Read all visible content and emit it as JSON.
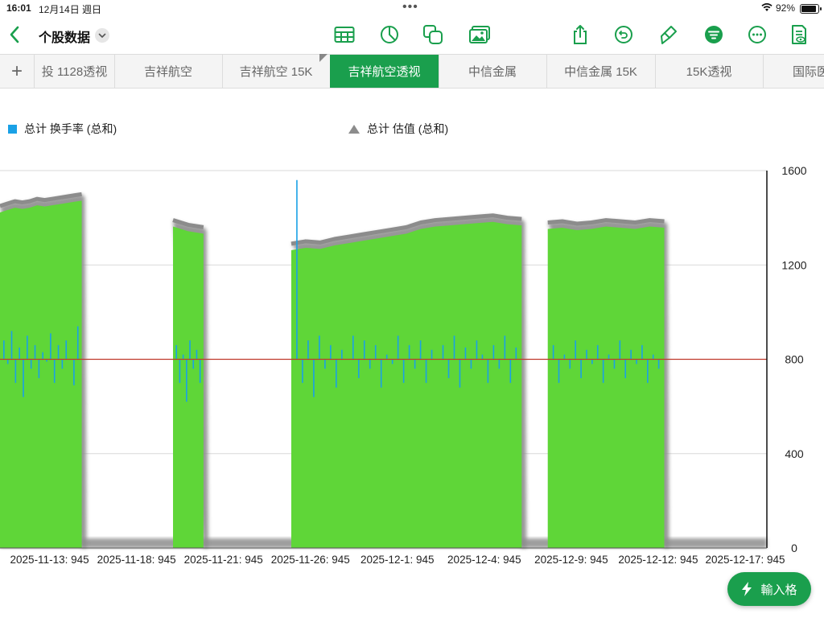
{
  "status_bar": {
    "time": "16:01",
    "date": "12月14日 週日",
    "battery": "92%",
    "battery_level": 0.92
  },
  "toolbar": {
    "title": "个股数据",
    "left_icons": [
      "back-icon",
      "chevron-down-icon"
    ],
    "center_icons": [
      "table-icon",
      "chart-icon",
      "shape-icon",
      "media-icon"
    ],
    "right_icons": [
      "share-icon",
      "undo-icon",
      "brush-icon",
      "organize-icon",
      "more-icon",
      "doc-view-icon"
    ]
  },
  "tabs": {
    "add_label": "+",
    "items": [
      {
        "label": "投 1128透视",
        "active": false
      },
      {
        "label": "吉祥航空",
        "active": false
      },
      {
        "label": "吉祥航空 15K",
        "active": false
      },
      {
        "label": "吉祥航空透视",
        "active": true
      },
      {
        "label": "中信金属",
        "active": false
      },
      {
        "label": "中信金属 15K",
        "active": false
      },
      {
        "label": "15K透视",
        "active": false
      },
      {
        "label": "国际医",
        "active": false
      }
    ]
  },
  "legend": {
    "turnover_label": "总计 换手率 (总和)",
    "valuation_label": "总计 估值 (总和)"
  },
  "fab": {
    "label": "輸入格",
    "icon": "bolt-icon"
  },
  "colors": {
    "accent": "#1a9f4d",
    "bar": "#5fd638",
    "turnover": "#1aa1e6",
    "shadow": "#8c8c8c",
    "zero_line": "#c0392b",
    "grid": "#d9d9d9"
  },
  "chart_data": {
    "type": "bar",
    "right_axis": {
      "ylim": [
        0,
        1600
      ],
      "ticks": [
        0,
        400,
        800,
        1200,
        1600
      ]
    },
    "x_tick_labels": [
      "2025-11-13: 945",
      "2025-11-18: 945",
      "2025-11-21: 945",
      "2025-11-26: 945",
      "2025-12-1: 945",
      "2025-12-4: 945",
      "2025-12-9: 945",
      "2025-12-12: 945",
      "2025-12-17: 945"
    ],
    "x_tick_index": [
      0,
      1,
      2,
      3,
      4,
      5,
      6,
      7,
      8
    ],
    "x_range": [
      -0.07,
      8.75
    ],
    "grid": true,
    "legend_position": "top",
    "series": [
      {
        "name": "总计 估值 (总和)",
        "kind": "bar",
        "segments": [
          {
            "x_start": -0.07,
            "x_end": 0.87,
            "values": [
              1450,
              1460,
              1470,
              1465,
              1470,
              1480,
              1475,
              1480,
              1485,
              1490,
              1495,
              1500
            ]
          },
          {
            "x_start": 1.92,
            "x_end": 2.27,
            "values": [
              1390,
              1370,
              1360
            ]
          },
          {
            "x_start": 3.28,
            "x_end": 5.93,
            "values": [
              1290,
              1300,
              1295,
              1310,
              1320,
              1330,
              1340,
              1350,
              1360,
              1380,
              1390,
              1395,
              1400,
              1405,
              1410,
              1400,
              1395
            ]
          },
          {
            "x_start": 6.23,
            "x_end": 7.57,
            "values": [
              1380,
              1385,
              1375,
              1380,
              1390,
              1385,
              1380,
              1390,
              1385
            ]
          }
        ]
      },
      {
        "name": "总计 换手率 (总和)",
        "kind": "line-bars",
        "baseline": 800,
        "segments": [
          {
            "x_start": -0.07,
            "x_end": 0.87,
            "values": [
              880,
              780,
              920,
              700,
              850,
              640,
              900,
              760,
              860,
              720,
              830,
              790,
              910,
              700,
              860,
              760,
              880,
              800,
              690,
              940
            ]
          },
          {
            "x_start": 1.92,
            "x_end": 2.27,
            "values": [
              860,
              700,
              820,
              620,
              880,
              760,
              840,
              700
            ]
          },
          {
            "x_start": 3.28,
            "x_end": 5.93,
            "values": [
              1560,
              700,
              880,
              640,
              900,
              760,
              860,
              680,
              840,
              800,
              900,
              720,
              880,
              760,
              860,
              680,
              820,
              780,
              900,
              700,
              860,
              760,
              880,
              700,
              840,
              800,
              860,
              720,
              900,
              680,
              850,
              760,
              880,
              820,
              700,
              860,
              760,
              900,
              700,
              850
            ]
          },
          {
            "x_start": 6.23,
            "x_end": 7.57,
            "values": [
              860,
              700,
              820,
              760,
              880,
              720,
              840,
              780,
              860,
              700,
              820,
              760,
              880,
              720,
              840,
              780,
              860,
              700,
              820,
              760
            ]
          }
        ]
      }
    ]
  }
}
